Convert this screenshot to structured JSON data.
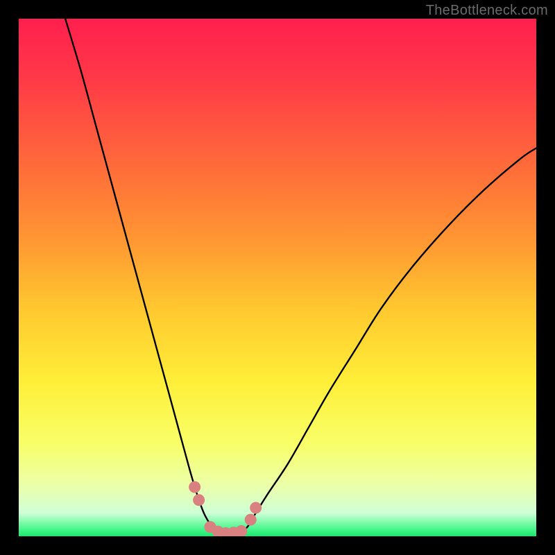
{
  "watermark": "TheBottleneck.com",
  "colors": {
    "frame": "#000000",
    "gradient_stops": [
      {
        "offset": 0.0,
        "color": "#ff1f4e"
      },
      {
        "offset": 0.12,
        "color": "#ff3a47"
      },
      {
        "offset": 0.28,
        "color": "#ff6a3a"
      },
      {
        "offset": 0.42,
        "color": "#ff9433"
      },
      {
        "offset": 0.56,
        "color": "#ffc82f"
      },
      {
        "offset": 0.7,
        "color": "#ffee38"
      },
      {
        "offset": 0.82,
        "color": "#f8ff67"
      },
      {
        "offset": 0.9,
        "color": "#ecffa8"
      },
      {
        "offset": 0.955,
        "color": "#cfffd6"
      },
      {
        "offset": 0.985,
        "color": "#4cf78e"
      },
      {
        "offset": 1.0,
        "color": "#17e96d"
      }
    ],
    "curve": "#000000",
    "marker_fill": "#d98080",
    "marker_stroke": "#a84f4f"
  },
  "chart_data": {
    "type": "line",
    "title": "",
    "xlabel": "",
    "ylabel": "",
    "xlim": [
      0,
      100
    ],
    "ylim": [
      0,
      100
    ],
    "note": "Bottleneck-style V curve. x ~ relative component strength, y ~ bottleneck severity (%). Minimum ≈ 0% around x≈40. Axes are unlabeled in the source image; values below are read from curve geometry relative to the plot box.",
    "series": [
      {
        "name": "bottleneck-curve",
        "x": [
          9,
          12,
          15,
          18,
          21,
          24,
          27,
          30,
          33,
          34.5,
          36,
          38,
          40,
          42,
          44,
          45.5,
          48,
          52,
          56,
          60,
          65,
          70,
          76,
          83,
          90,
          97,
          100
        ],
        "y": [
          100,
          90,
          79,
          68,
          57,
          46,
          35,
          24,
          13,
          8,
          4,
          1.2,
          0.4,
          0.6,
          1.6,
          4,
          8,
          14,
          21,
          28,
          36,
          44,
          52,
          60,
          67,
          73,
          75
        ]
      }
    ],
    "markers": {
      "name": "highlight-points",
      "note": "Salmon dots near the curve minimum; approximate (x, severity%) pairs.",
      "points": [
        {
          "x": 34.0,
          "y": 9.5
        },
        {
          "x": 34.8,
          "y": 7.0
        },
        {
          "x": 37.0,
          "y": 1.8
        },
        {
          "x": 38.5,
          "y": 0.9
        },
        {
          "x": 40.0,
          "y": 0.6
        },
        {
          "x": 41.5,
          "y": 0.7
        },
        {
          "x": 43.0,
          "y": 1.0
        },
        {
          "x": 44.8,
          "y": 3.2
        },
        {
          "x": 45.8,
          "y": 5.5
        }
      ]
    }
  }
}
